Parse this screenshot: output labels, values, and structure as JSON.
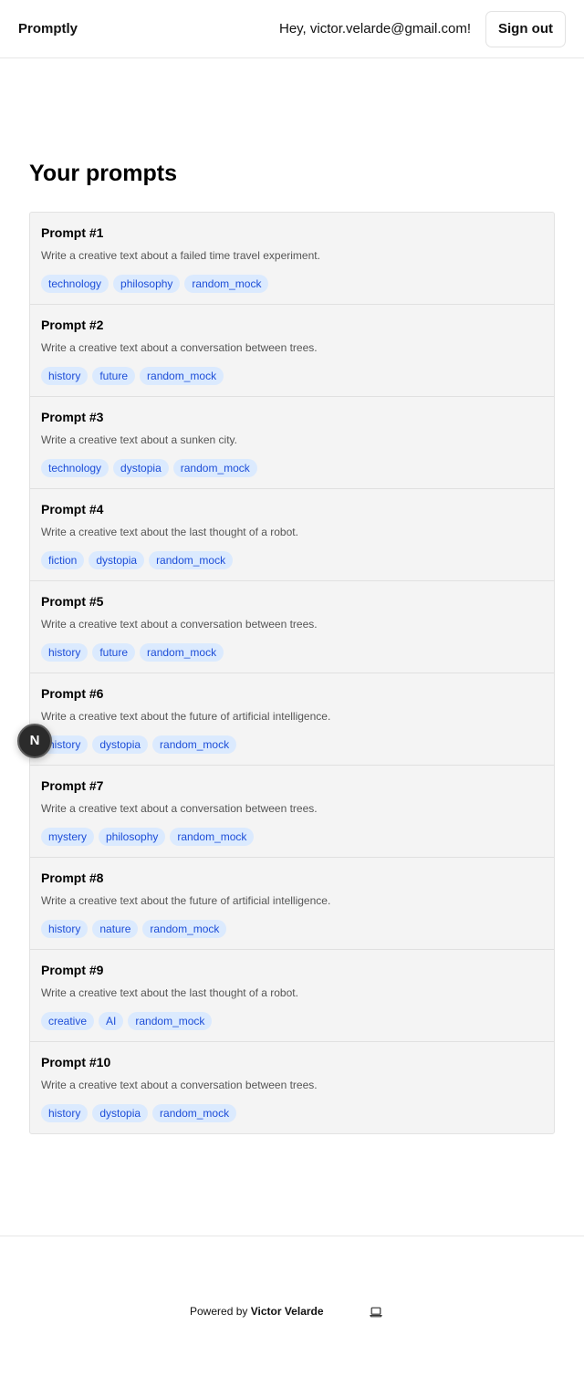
{
  "header": {
    "brand": "Promptly",
    "greeting": "Hey, victor.velarde@gmail.com!",
    "sign_out_label": "Sign out"
  },
  "main": {
    "title": "Your prompts",
    "prompts": [
      {
        "title": "Prompt #1",
        "text": "Write a creative text about a failed time travel experiment.",
        "tags": [
          "technology",
          "philosophy",
          "random_mock"
        ]
      },
      {
        "title": "Prompt #2",
        "text": "Write a creative text about a conversation between trees.",
        "tags": [
          "history",
          "future",
          "random_mock"
        ]
      },
      {
        "title": "Prompt #3",
        "text": "Write a creative text about a sunken city.",
        "tags": [
          "technology",
          "dystopia",
          "random_mock"
        ]
      },
      {
        "title": "Prompt #4",
        "text": "Write a creative text about the last thought of a robot.",
        "tags": [
          "fiction",
          "dystopia",
          "random_mock"
        ]
      },
      {
        "title": "Prompt #5",
        "text": "Write a creative text about a conversation between trees.",
        "tags": [
          "history",
          "future",
          "random_mock"
        ]
      },
      {
        "title": "Prompt #6",
        "text": "Write a creative text about the future of artificial intelligence.",
        "tags": [
          "history",
          "dystopia",
          "random_mock"
        ]
      },
      {
        "title": "Prompt #7",
        "text": "Write a creative text about a conversation between trees.",
        "tags": [
          "mystery",
          "philosophy",
          "random_mock"
        ]
      },
      {
        "title": "Prompt #8",
        "text": "Write a creative text about the future of artificial intelligence.",
        "tags": [
          "history",
          "nature",
          "random_mock"
        ]
      },
      {
        "title": "Prompt #9",
        "text": "Write a creative text about the last thought of a robot.",
        "tags": [
          "creative",
          "AI",
          "random_mock"
        ]
      },
      {
        "title": "Prompt #10",
        "text": "Write a creative text about a conversation between trees.",
        "tags": [
          "history",
          "dystopia",
          "random_mock"
        ]
      }
    ]
  },
  "overlay": {
    "badge_letter": "N"
  },
  "footer": {
    "powered_prefix": "Powered by",
    "author": "Victor Velarde",
    "icon": "laptop-icon"
  },
  "colors": {
    "tag_background": "#dbeafe",
    "tag_text": "#1d4ed8",
    "card_background": "#f4f4f4"
  }
}
